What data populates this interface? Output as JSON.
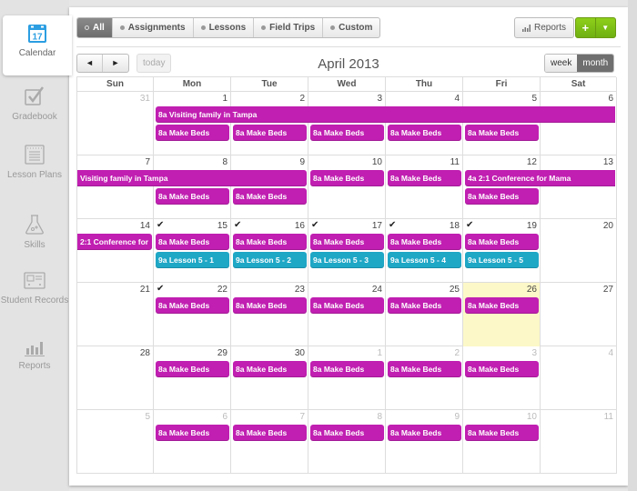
{
  "colors": {
    "assignment": "#c01fb1",
    "lesson": "#1fa7c6",
    "today_bg": "#fcf8c8",
    "add_button": "#7fc016",
    "calendar_icon": "#2b9ee2"
  },
  "sidebar": {
    "items": [
      {
        "label": "Calendar",
        "icon": "calendar-icon",
        "active": true
      },
      {
        "label": "Gradebook",
        "icon": "checkbox-icon"
      },
      {
        "label": "Lesson Plans",
        "icon": "notepad-icon"
      },
      {
        "label": "Skills",
        "icon": "flask-icon"
      },
      {
        "label": "Student Records",
        "icon": "id-card-icon"
      },
      {
        "label": "Reports",
        "icon": "bar-chart-icon"
      }
    ],
    "calendar_icon_day": "17"
  },
  "toolbar": {
    "filters": [
      {
        "label": "All",
        "active": true
      },
      {
        "label": "Assignments"
      },
      {
        "label": "Lessons"
      },
      {
        "label": "Field Trips"
      },
      {
        "label": "Custom"
      }
    ],
    "reports_label": "Reports",
    "add_label": "+",
    "add_dropdown": "▼",
    "prev": "◄",
    "next": "►",
    "today_label": "today",
    "month_title": "April 2013",
    "views": [
      {
        "label": "week"
      },
      {
        "label": "month",
        "active": true
      }
    ]
  },
  "calendar": {
    "day_headers": [
      "Sun",
      "Mon",
      "Tue",
      "Wed",
      "Thu",
      "Fri",
      "Sat"
    ],
    "weeks": [
      {
        "days": [
          {
            "num": "31",
            "other": true
          },
          {
            "num": "1"
          },
          {
            "num": "2"
          },
          {
            "num": "3"
          },
          {
            "num": "4"
          },
          {
            "num": "5"
          },
          {
            "num": "6"
          }
        ],
        "events": [
          {
            "title": "8a Visiting family in Tampa",
            "type": "assignment",
            "start": 1,
            "span": 6,
            "row": 0
          },
          {
            "title": "8a Make Beds",
            "type": "assignment",
            "start": 1,
            "span": 1,
            "row": 1
          },
          {
            "title": "8a Make Beds",
            "type": "assignment",
            "start": 2,
            "span": 1,
            "row": 1
          },
          {
            "title": "8a Make Beds",
            "type": "assignment",
            "start": 3,
            "span": 1,
            "row": 1
          },
          {
            "title": "8a Make Beds",
            "type": "assignment",
            "start": 4,
            "span": 1,
            "row": 1
          },
          {
            "title": "8a Make Beds",
            "type": "assignment",
            "start": 5,
            "span": 1,
            "row": 1
          }
        ]
      },
      {
        "days": [
          {
            "num": "7"
          },
          {
            "num": "8"
          },
          {
            "num": "9"
          },
          {
            "num": "10"
          },
          {
            "num": "11"
          },
          {
            "num": "12"
          },
          {
            "num": "13"
          }
        ],
        "events": [
          {
            "title": "Visiting family in Tampa",
            "type": "assignment",
            "start": 0,
            "span": 3,
            "row": 0
          },
          {
            "title": "8a Make Beds",
            "type": "assignment",
            "start": 3,
            "span": 1,
            "row": 0
          },
          {
            "title": "8a Make Beds",
            "type": "assignment",
            "start": 4,
            "span": 1,
            "row": 0
          },
          {
            "title": "4a 2:1 Conference for Mama",
            "type": "assignment",
            "start": 5,
            "span": 2,
            "row": 0
          },
          {
            "title": "8a Make Beds",
            "type": "assignment",
            "start": 1,
            "span": 1,
            "row": 1
          },
          {
            "title": "8a Make Beds",
            "type": "assignment",
            "start": 2,
            "span": 1,
            "row": 1
          },
          {
            "title": "8a Make Beds",
            "type": "assignment",
            "start": 5,
            "span": 1,
            "row": 1
          }
        ]
      },
      {
        "days": [
          {
            "num": "14"
          },
          {
            "num": "15",
            "check": true
          },
          {
            "num": "16",
            "check": true
          },
          {
            "num": "17",
            "check": true
          },
          {
            "num": "18",
            "check": true
          },
          {
            "num": "19",
            "check": true
          },
          {
            "num": "20"
          }
        ],
        "events": [
          {
            "title": "2:1 Conference for",
            "type": "assignment",
            "start": 0,
            "span": 1,
            "row": 0
          },
          {
            "title": "8a Make Beds",
            "type": "assignment",
            "start": 1,
            "span": 1,
            "row": 0
          },
          {
            "title": "8a Make Beds",
            "type": "assignment",
            "start": 2,
            "span": 1,
            "row": 0
          },
          {
            "title": "8a Make Beds",
            "type": "assignment",
            "start": 3,
            "span": 1,
            "row": 0
          },
          {
            "title": "8a Make Beds",
            "type": "assignment",
            "start": 4,
            "span": 1,
            "row": 0
          },
          {
            "title": "8a Make Beds",
            "type": "assignment",
            "start": 5,
            "span": 1,
            "row": 0
          },
          {
            "title": "9a Lesson 5 - 1",
            "type": "lesson",
            "start": 1,
            "span": 1,
            "row": 1
          },
          {
            "title": "9a Lesson 5 - 2",
            "type": "lesson",
            "start": 2,
            "span": 1,
            "row": 1
          },
          {
            "title": "9a Lesson 5 - 3",
            "type": "lesson",
            "start": 3,
            "span": 1,
            "row": 1
          },
          {
            "title": "9a Lesson 5 - 4",
            "type": "lesson",
            "start": 4,
            "span": 1,
            "row": 1
          },
          {
            "title": "9a Lesson 5 - 5",
            "type": "lesson",
            "start": 5,
            "span": 1,
            "row": 1
          }
        ]
      },
      {
        "days": [
          {
            "num": "21"
          },
          {
            "num": "22",
            "check": true
          },
          {
            "num": "23"
          },
          {
            "num": "24"
          },
          {
            "num": "25"
          },
          {
            "num": "26",
            "today": true
          },
          {
            "num": "27"
          }
        ],
        "events": [
          {
            "title": "8a Make Beds",
            "type": "assignment",
            "start": 1,
            "span": 1,
            "row": 0
          },
          {
            "title": "8a Make Beds",
            "type": "assignment",
            "start": 2,
            "span": 1,
            "row": 0
          },
          {
            "title": "8a Make Beds",
            "type": "assignment",
            "start": 3,
            "span": 1,
            "row": 0
          },
          {
            "title": "8a Make Beds",
            "type": "assignment",
            "start": 4,
            "span": 1,
            "row": 0
          },
          {
            "title": "8a Make Beds",
            "type": "assignment",
            "start": 5,
            "span": 1,
            "row": 0
          }
        ]
      },
      {
        "days": [
          {
            "num": "28"
          },
          {
            "num": "29"
          },
          {
            "num": "30"
          },
          {
            "num": "1",
            "other": true
          },
          {
            "num": "2",
            "other": true
          },
          {
            "num": "3",
            "other": true
          },
          {
            "num": "4",
            "other": true
          }
        ],
        "events": [
          {
            "title": "8a Make Beds",
            "type": "assignment",
            "start": 1,
            "span": 1,
            "row": 0
          },
          {
            "title": "8a Make Beds",
            "type": "assignment",
            "start": 2,
            "span": 1,
            "row": 0
          },
          {
            "title": "8a Make Beds",
            "type": "assignment",
            "start": 3,
            "span": 1,
            "row": 0
          },
          {
            "title": "8a Make Beds",
            "type": "assignment",
            "start": 4,
            "span": 1,
            "row": 0
          },
          {
            "title": "8a Make Beds",
            "type": "assignment",
            "start": 5,
            "span": 1,
            "row": 0
          }
        ]
      },
      {
        "days": [
          {
            "num": "5",
            "other": true
          },
          {
            "num": "6",
            "other": true
          },
          {
            "num": "7",
            "other": true
          },
          {
            "num": "8",
            "other": true
          },
          {
            "num": "9",
            "other": true
          },
          {
            "num": "10",
            "other": true
          },
          {
            "num": "11",
            "other": true
          }
        ],
        "events": [
          {
            "title": "8a Make Beds",
            "type": "assignment",
            "start": 1,
            "span": 1,
            "row": 0
          },
          {
            "title": "8a Make Beds",
            "type": "assignment",
            "start": 2,
            "span": 1,
            "row": 0
          },
          {
            "title": "8a Make Beds",
            "type": "assignment",
            "start": 3,
            "span": 1,
            "row": 0
          },
          {
            "title": "8a Make Beds",
            "type": "assignment",
            "start": 4,
            "span": 1,
            "row": 0
          },
          {
            "title": "8a Make Beds",
            "type": "assignment",
            "start": 5,
            "span": 1,
            "row": 0
          }
        ]
      }
    ]
  }
}
